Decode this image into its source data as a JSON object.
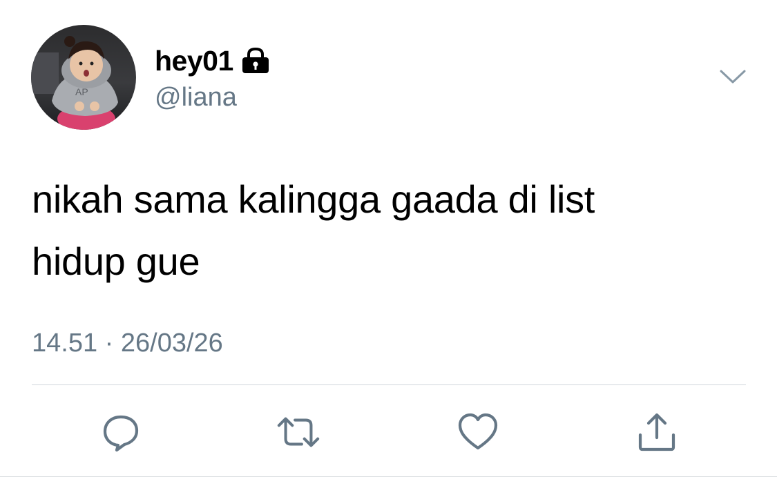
{
  "tweet": {
    "display_name": "hey01",
    "handle": "@liana",
    "text": "nikah sama kalingga gaada di list\nhidup gue",
    "timestamp": "14.51 · 26/03/26",
    "protected_icon": "lock-icon",
    "menu_icon": "chevron-down-icon"
  },
  "actions": [
    {
      "name": "reply",
      "icon": "reply-icon"
    },
    {
      "name": "retweet",
      "icon": "retweet-icon"
    },
    {
      "name": "like",
      "icon": "heart-icon"
    },
    {
      "name": "share",
      "icon": "share-icon"
    }
  ],
  "colors": {
    "secondary_text": "#657786",
    "icon": "#657786",
    "divider": "#cfd6dc"
  }
}
